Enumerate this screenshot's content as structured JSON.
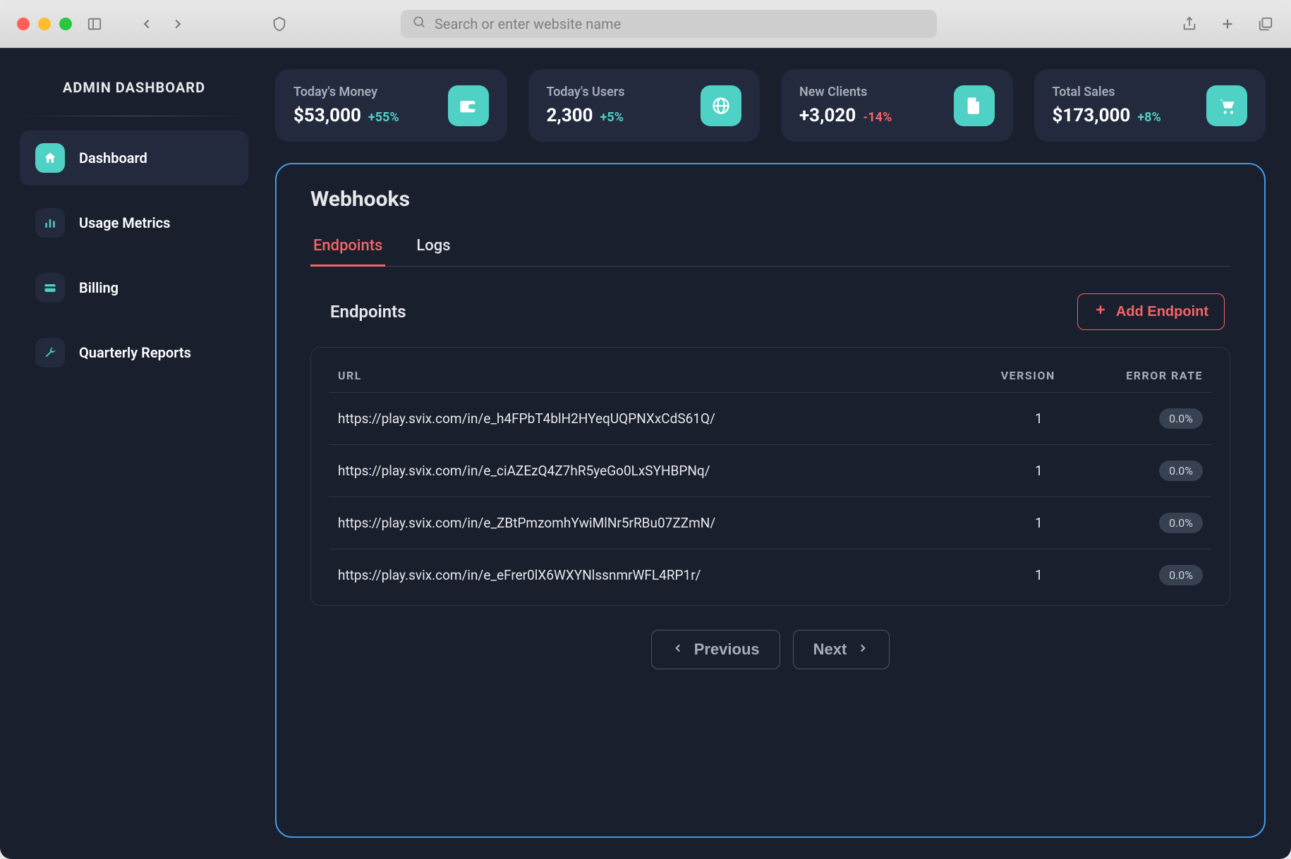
{
  "browser": {
    "search_placeholder": "Search or enter website name"
  },
  "sidebar": {
    "title": "ADMIN DASHBOARD",
    "items": [
      {
        "label": "Dashboard",
        "icon": "home-icon",
        "active": true
      },
      {
        "label": "Usage Metrics",
        "icon": "bar-chart-icon",
        "active": false
      },
      {
        "label": "Billing",
        "icon": "card-icon",
        "active": false
      },
      {
        "label": "Quarterly Reports",
        "icon": "wrench-icon",
        "active": false
      }
    ]
  },
  "stats": [
    {
      "label": "Today's Money",
      "value": "$53,000",
      "delta": "+55%",
      "delta_dir": "up",
      "icon": "wallet-icon"
    },
    {
      "label": "Today's Users",
      "value": "2,300",
      "delta": "+5%",
      "delta_dir": "up",
      "icon": "globe-icon"
    },
    {
      "label": "New Clients",
      "value": "+3,020",
      "delta": "-14%",
      "delta_dir": "down",
      "icon": "file-icon"
    },
    {
      "label": "Total Sales",
      "value": "$173,000",
      "delta": "+8%",
      "delta_dir": "up",
      "icon": "cart-icon"
    }
  ],
  "webhooks": {
    "title": "Webhooks",
    "tabs": [
      {
        "label": "Endpoints",
        "active": true
      },
      {
        "label": "Logs",
        "active": false
      }
    ],
    "subtitle": "Endpoints",
    "add_button_label": "Add Endpoint",
    "columns": {
      "url": "URL",
      "version": "VERSION",
      "error_rate": "ERROR RATE"
    },
    "rows": [
      {
        "url": "https://play.svix.com/in/e_h4FPbT4blH2HYeqUQPNXxCdS61Q/",
        "version": "1",
        "error_rate": "0.0%"
      },
      {
        "url": "https://play.svix.com/in/e_ciAZEzQ4Z7hR5yeGo0LxSYHBPNq/",
        "version": "1",
        "error_rate": "0.0%"
      },
      {
        "url": "https://play.svix.com/in/e_ZBtPmzomhYwiMlNr5rRBu07ZZmN/",
        "version": "1",
        "error_rate": "0.0%"
      },
      {
        "url": "https://play.svix.com/in/e_eFrer0lX6WXYNlssnmrWFL4RP1r/",
        "version": "1",
        "error_rate": "0.0%"
      }
    ],
    "pagination": {
      "prev": "Previous",
      "next": "Next"
    }
  },
  "colors": {
    "accent_teal": "#4FD1C5",
    "accent_red": "#F56565",
    "panel_border": "#4299e1",
    "bg_app": "#1a1f2e",
    "bg_card": "#232a3d"
  }
}
